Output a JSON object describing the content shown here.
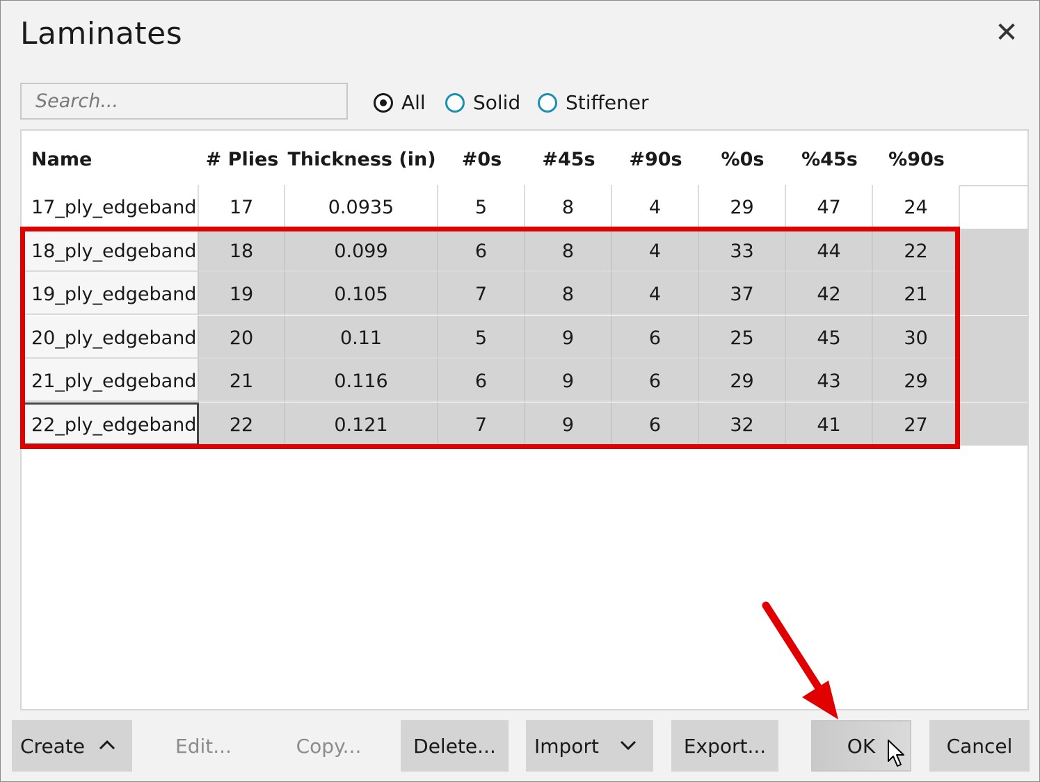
{
  "dialog": {
    "title": "Laminates",
    "close_label": "✕"
  },
  "search": {
    "placeholder": "Search..."
  },
  "filters": [
    {
      "label": "All",
      "checked": true
    },
    {
      "label": "Solid",
      "checked": false
    },
    {
      "label": "Stiffener",
      "checked": false
    }
  ],
  "table": {
    "columns": [
      "Name",
      "# Plies",
      "Thickness (in)",
      "#0s",
      "#45s",
      "#90s",
      "%0s",
      "%45s",
      "%90s"
    ],
    "rows": [
      [
        "17_ply_edgeband",
        "17",
        "0.0935",
        "5",
        "8",
        "4",
        "29",
        "47",
        "24"
      ],
      [
        "18_ply_edgeband",
        "18",
        "0.099",
        "6",
        "8",
        "4",
        "33",
        "44",
        "22"
      ],
      [
        "19_ply_edgeband",
        "19",
        "0.105",
        "7",
        "8",
        "4",
        "37",
        "42",
        "21"
      ],
      [
        "20_ply_edgeband",
        "20",
        "0.11",
        "5",
        "9",
        "6",
        "25",
        "45",
        "30"
      ],
      [
        "21_ply_edgeband",
        "21",
        "0.116",
        "6",
        "9",
        "6",
        "29",
        "43",
        "29"
      ],
      [
        "22_ply_edgeband",
        "22",
        "0.121",
        "7",
        "9",
        "6",
        "32",
        "41",
        "27"
      ]
    ],
    "selected_rows": [
      1,
      2,
      3,
      4,
      5
    ],
    "focused_row": 5
  },
  "buttons": {
    "create": "Create",
    "edit": "Edit...",
    "copy": "Copy...",
    "delete": "Delete...",
    "import": "Import",
    "export": "Export...",
    "ok": "OK",
    "cancel": "Cancel"
  },
  "colors": {
    "highlight": "#e00000",
    "radio_accent": "#1a8fb0",
    "selected_row": "#d4d4d4"
  }
}
